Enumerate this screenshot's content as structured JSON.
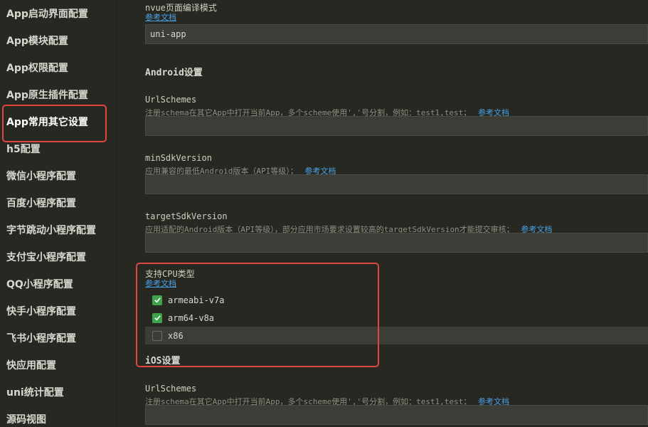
{
  "sidebar": {
    "items": [
      {
        "label": "App启动界面配置"
      },
      {
        "label": "App模块配置"
      },
      {
        "label": "App权限配置"
      },
      {
        "label": "App原生插件配置"
      },
      {
        "label": "App常用其它设置"
      },
      {
        "label": "h5配置"
      },
      {
        "label": "微信小程序配置"
      },
      {
        "label": "百度小程序配置"
      },
      {
        "label": "字节跳动小程序配置"
      },
      {
        "label": "支付宝小程序配置"
      },
      {
        "label": "QQ小程序配置"
      },
      {
        "label": "快手小程序配置"
      },
      {
        "label": "飞书小程序配置"
      },
      {
        "label": "快应用配置"
      },
      {
        "label": "uni统计配置"
      },
      {
        "label": "源码视图"
      }
    ],
    "active_index": 4
  },
  "main": {
    "nvue": {
      "title": "nvue页面编译模式",
      "link": "参考文档",
      "value": "uni-app"
    },
    "android_section": "Android设置",
    "android_urlschemes": {
      "title": "UrlSchemes",
      "desc": "注册schema在其它App中打开当前App，多个scheme使用','号分割，例如：test1,test；",
      "link": "参考文档",
      "value": ""
    },
    "min_sdk": {
      "title": "minSdkVersion",
      "desc": "应用兼容的最低Android版本（API等级）；",
      "link": "参考文档",
      "value": ""
    },
    "target_sdk": {
      "title": "targetSdkVersion",
      "desc": "应用适配的Android版本（API等级），部分应用市场要求设置较高的targetSdkVersion才能提交审核；",
      "link": "参考文档",
      "value": ""
    },
    "cpu": {
      "title": "支持CPU类型",
      "link": "参考文档",
      "options": [
        {
          "label": "armeabi-v7a",
          "checked": true
        },
        {
          "label": "arm64-v8a",
          "checked": true
        },
        {
          "label": "x86",
          "checked": false
        }
      ]
    },
    "ios_section": "iOS设置",
    "ios_urlschemes": {
      "title": "UrlSchemes",
      "desc": "注册schema在其它App中打开当前App，多个scheme使用','号分割，例如：test1,test；",
      "link": "参考文档",
      "value": ""
    }
  },
  "colors": {
    "background": "#272822",
    "input_bg": "#3c3d37",
    "link": "#4aa3e8",
    "checkbox_checked": "#3ea34a",
    "highlight_box": "#e0463f"
  }
}
